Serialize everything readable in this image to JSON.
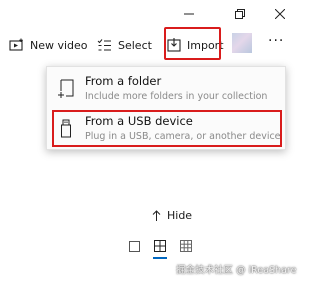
{
  "titlebar": {
    "minimize_icon": "minimize-icon",
    "restore_icon": "restore-icon",
    "close_icon": "close-icon"
  },
  "toolbar": {
    "new_video_label": "New video",
    "select_label": "Select",
    "import_label": "Import",
    "more_label": "···"
  },
  "import_menu": {
    "items": [
      {
        "title": "From a folder",
        "subtitle": "Include more folders in your collection",
        "icon": "folder-add-icon"
      },
      {
        "title": "From a USB device",
        "subtitle": "Plug in a USB, camera, or another device",
        "icon": "usb-icon"
      }
    ]
  },
  "hide_label": "Hide",
  "view_modes": [
    "single",
    "medium-grid",
    "small-grid"
  ],
  "watermark": "掘金技术社区 @ iReaShare",
  "colors": {
    "highlight": "#d91c1c",
    "accent": "#0067c0"
  }
}
